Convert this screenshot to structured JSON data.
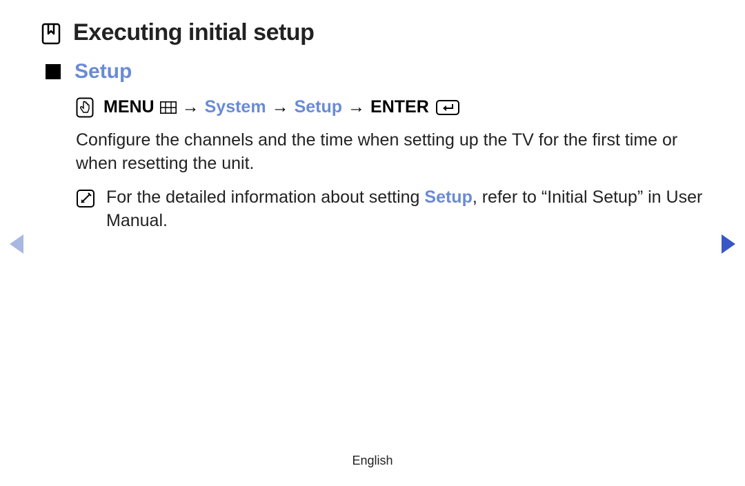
{
  "page": {
    "title": "Executing initial setup"
  },
  "section": {
    "heading": "Setup"
  },
  "navpath": {
    "menu": "MENU",
    "sep": "→",
    "system": "System",
    "setup": "Setup",
    "enter": "ENTER"
  },
  "body": {
    "text": "Configure the channels and the time when setting up the TV for the first time or when resetting the unit."
  },
  "note": {
    "prefix": "For the detailed information about setting ",
    "highlight": "Setup",
    "suffix": ", refer to “Initial Setup” in User Manual."
  },
  "footer": {
    "language": "English"
  }
}
